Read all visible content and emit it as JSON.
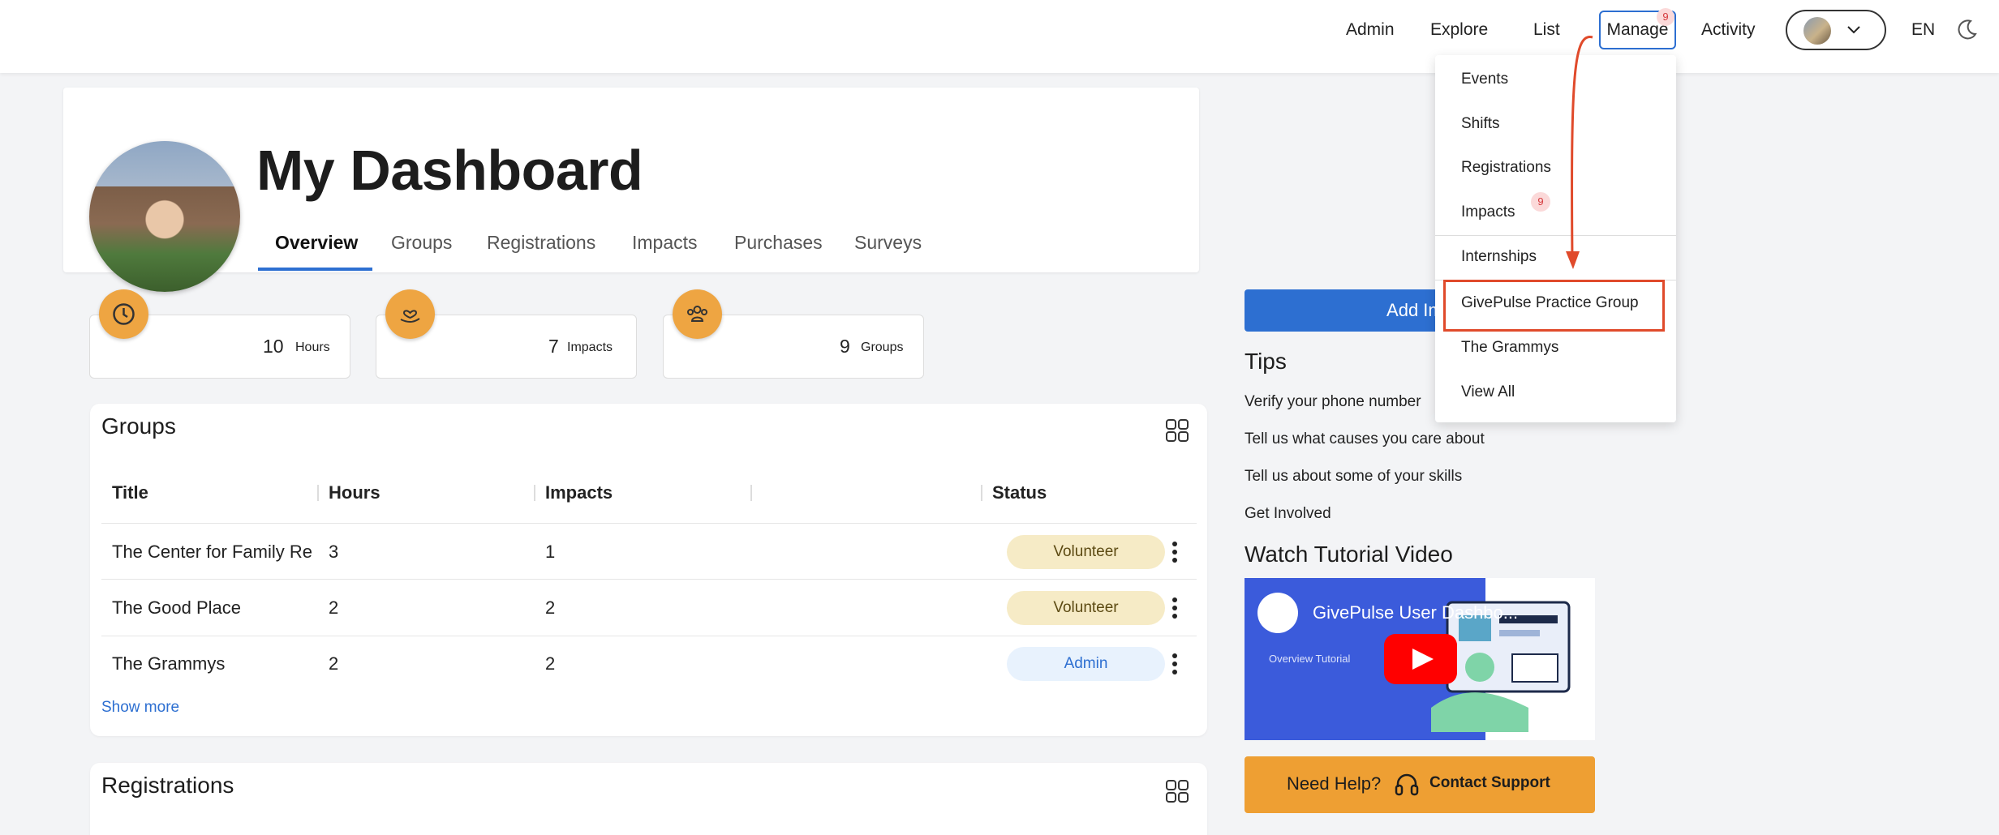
{
  "nav": {
    "links": [
      "Admin",
      "Explore",
      "List",
      "Manage",
      "Activity"
    ],
    "manage_badge": "9",
    "language": "EN"
  },
  "header": {
    "title": "My Dashboard",
    "tabs": [
      "Overview",
      "Groups",
      "Registrations",
      "Impacts",
      "Purchases",
      "Surveys"
    ],
    "active_tab": "Overview"
  },
  "stats": [
    {
      "value": "10",
      "unit": "Hours",
      "icon": "clock-icon"
    },
    {
      "value": "7",
      "unit": "Impacts",
      "icon": "heart-hand-icon"
    },
    {
      "value": "9",
      "unit": "Groups",
      "icon": "people-icon"
    }
  ],
  "groups": {
    "title": "Groups",
    "columns": [
      "Title",
      "Hours",
      "Impacts",
      "",
      "Status"
    ],
    "rows": [
      {
        "title": "The Center for Family Re",
        "hours": "3",
        "impacts": "1",
        "status": "Volunteer"
      },
      {
        "title": "The Good Place",
        "hours": "2",
        "impacts": "2",
        "status": "Volunteer"
      },
      {
        "title": "The Grammys",
        "hours": "2",
        "impacts": "2",
        "status": "Admin"
      }
    ],
    "show_more": "Show more"
  },
  "registrations": {
    "title": "Registrations"
  },
  "sidebar": {
    "add_button": "Add Imp",
    "tips_title": "Tips",
    "tips": [
      "Verify your phone number",
      "Tell us what causes you care about",
      "Tell us about some of your skills",
      "Get Involved"
    ],
    "video_title": "Watch Tutorial Video",
    "video_heading": "GivePulse User Dashbo...",
    "video_subtitle": "Overview Tutorial",
    "help_text": "Need Help?",
    "contact_text": "Contact Support"
  },
  "dropdown": {
    "items": [
      "Events",
      "Shifts",
      "Registrations",
      "Impacts",
      "Internships",
      "GivePulse Practice Group",
      "The Grammys",
      "View All"
    ],
    "impacts_badge": "9",
    "highlighted": "GivePulse Practice Group"
  },
  "colors": {
    "accent": "#2d6fd1",
    "stat_orange": "#eea542",
    "help_orange": "#ee9f33",
    "highlight": "#e04a2b"
  }
}
